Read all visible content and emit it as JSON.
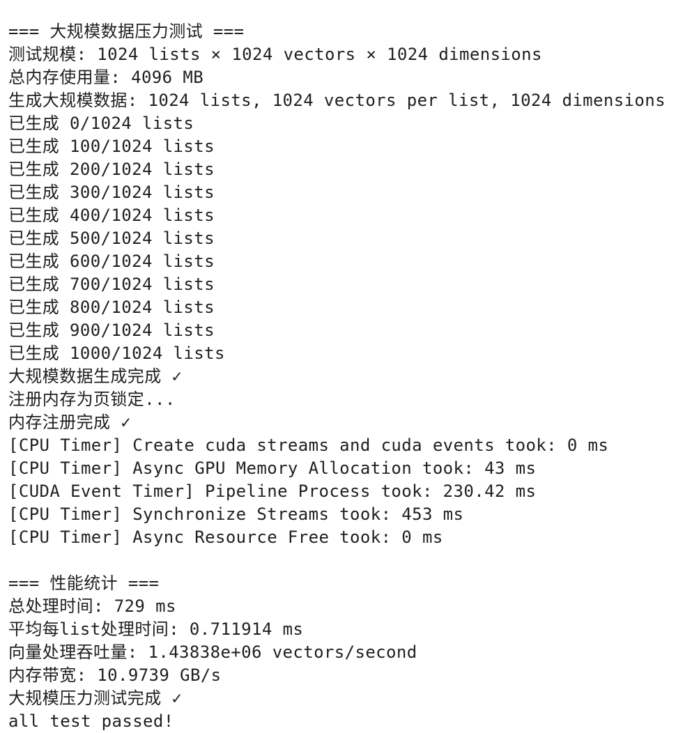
{
  "terminal": {
    "lines": [
      "=== 大规模数据压力测试 ===",
      "测试规模: 1024 lists × 1024 vectors × 1024 dimensions",
      "总内存使用量: 4096 MB",
      "生成大规模数据: 1024 lists, 1024 vectors per list, 1024 dimensions",
      "已生成 0/1024 lists",
      "已生成 100/1024 lists",
      "已生成 200/1024 lists",
      "已生成 300/1024 lists",
      "已生成 400/1024 lists",
      "已生成 500/1024 lists",
      "已生成 600/1024 lists",
      "已生成 700/1024 lists",
      "已生成 800/1024 lists",
      "已生成 900/1024 lists",
      "已生成 1000/1024 lists",
      "大规模数据生成完成 ✓",
      "注册内存为页锁定...",
      "内存注册完成 ✓",
      "[CPU Timer] Create cuda streams and cuda events took: 0 ms",
      "[CPU Timer] Async GPU Memory Allocation took: 43 ms",
      "[CUDA Event Timer] Pipeline Process took: 230.42 ms",
      "[CPU Timer] Synchronize Streams took: 453 ms",
      "[CPU Timer] Async Resource Free took: 0 ms",
      "",
      "=== 性能统计 ===",
      "总处理时间: 729 ms",
      "平均每list处理时间: 0.711914 ms",
      "向量处理吞吐量: 1.43838e+06 vectors/second",
      "内存带宽: 10.9739 GB/s",
      "大规模压力测试完成 ✓",
      "all test passed!"
    ]
  }
}
